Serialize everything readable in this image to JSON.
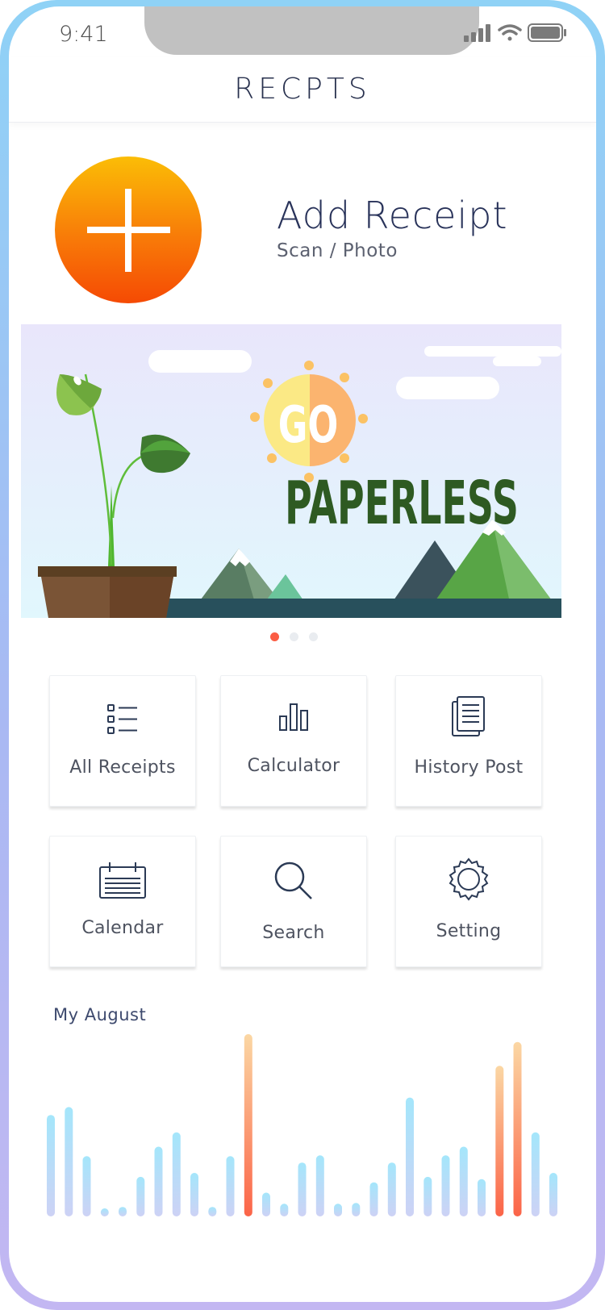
{
  "status_bar": {
    "time": "9:41"
  },
  "header": {
    "title": "RECPTS"
  },
  "add_receipt": {
    "title": "Add Receipt",
    "subtitle": "Scan / Photo"
  },
  "banner": {
    "line1": "GO",
    "line2": "PAPERLESS",
    "page_count": 3,
    "active_page": 0,
    "colors": {
      "title": "#2e5a22",
      "accent": "#fb5d44"
    }
  },
  "menu": {
    "all_receipts": "All Receipts",
    "calculator": "Calculator",
    "history_post": "History Post",
    "calendar": "Calendar",
    "search": "Search",
    "setting": "Setting"
  },
  "chart_section": {
    "title": "My August"
  },
  "chart_data": {
    "type": "bar",
    "title": "My August",
    "values": [
      128,
      138,
      76,
      8,
      12,
      50,
      88,
      106,
      55,
      12,
      76,
      230,
      30,
      16,
      68,
      77,
      16,
      17,
      43,
      68,
      150,
      50,
      77,
      88,
      47,
      190,
      220,
      106,
      55
    ],
    "highlighted": [
      11,
      25,
      26
    ],
    "colors": {
      "normal_top": "#a4e6fb",
      "normal_bottom": "#cdd2f5",
      "highlight_top": "#fbd7a4",
      "highlight_bottom": "#fb6448"
    }
  }
}
